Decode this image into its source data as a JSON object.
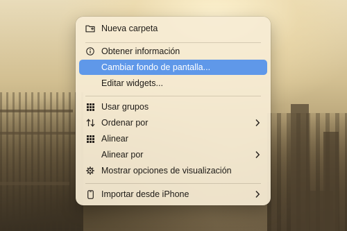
{
  "context_menu": {
    "items": [
      {
        "label": "Nueva carpeta",
        "icon": "new-folder-icon"
      },
      {
        "label": "Obtener información",
        "icon": "info-icon"
      },
      {
        "label": "Cambiar fondo de pantalla...",
        "selected": true
      },
      {
        "label": "Editar widgets..."
      },
      {
        "label": "Usar grupos",
        "icon": "grid-icon"
      },
      {
        "label": "Ordenar por",
        "icon": "sort-arrows-icon",
        "submenu": true
      },
      {
        "label": "Alinear",
        "icon": "grid-icon"
      },
      {
        "label": "Alinear por",
        "submenu": true
      },
      {
        "label": "Mostrar opciones de visualización",
        "icon": "gear-icon"
      },
      {
        "label": "Importar desde iPhone",
        "icon": "iphone-icon",
        "submenu": true
      }
    ]
  },
  "colors": {
    "highlight": "#5f98e9",
    "menu_background": "#f6ecd4",
    "text": "#1d1a16"
  }
}
